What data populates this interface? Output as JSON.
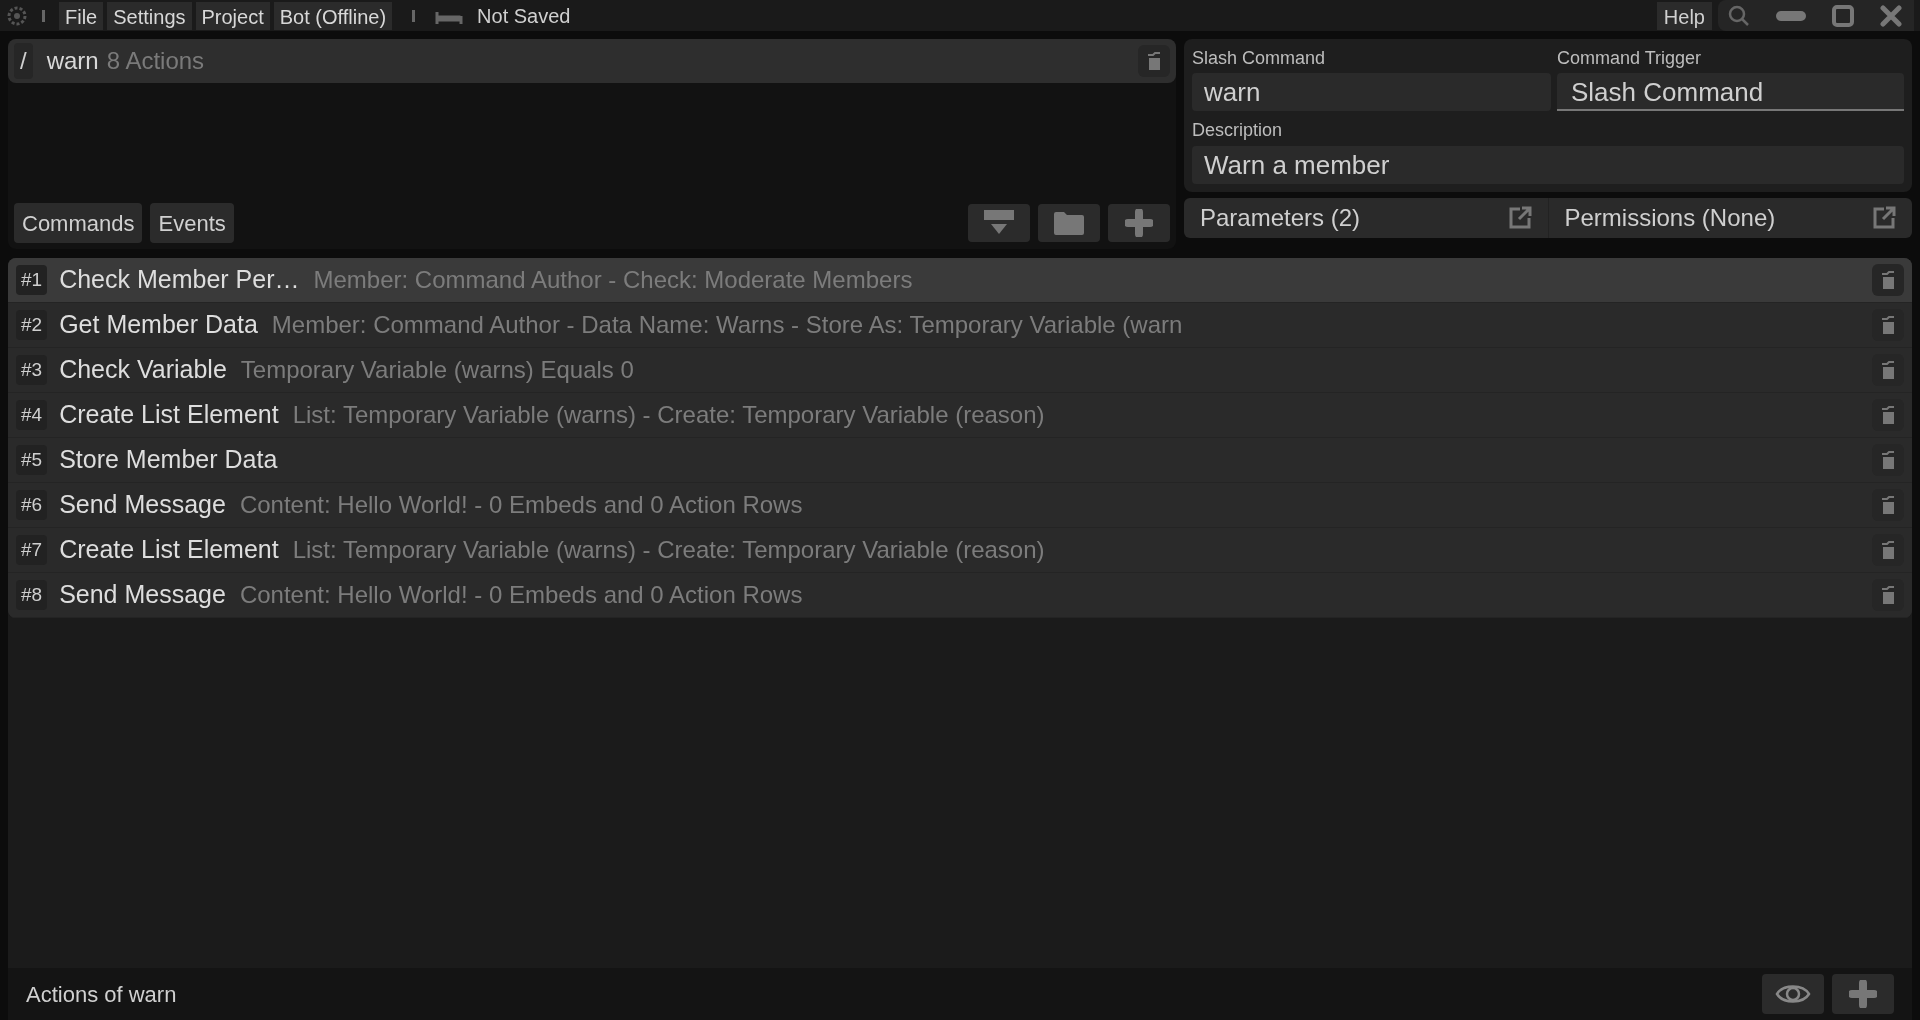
{
  "menu_bar": {
    "menus": [
      "File",
      "Settings",
      "Project",
      "Bot (Offline)"
    ],
    "save_status": "Not Saved",
    "help": "Help"
  },
  "command_header": {
    "prefix": "/",
    "name": "warn",
    "action_count": "8 Actions"
  },
  "list_tabs": [
    {
      "label": "Commands"
    },
    {
      "label": "Events"
    }
  ],
  "command_settings": {
    "slash_command": {
      "label": "Slash Command",
      "value": "warn"
    },
    "trigger": {
      "label": "Command Trigger",
      "value": "Slash Command"
    },
    "description": {
      "label": "Description",
      "value": "Warn a member"
    },
    "parameters": "Parameters (2)",
    "permissions": "Permissions (None)"
  },
  "actions": [
    {
      "number": "#1",
      "name": "Check Member Per…",
      "summary": "Member: Command Author - Check: Moderate Members",
      "selected": true
    },
    {
      "number": "#2",
      "name": "Get Member Data",
      "summary": "Member: Command Author - Data Name: Warns - Store As: Temporary Variable (warn",
      "selected": false
    },
    {
      "number": "#3",
      "name": "Check Variable",
      "summary": "Temporary Variable (warns) Equals 0",
      "selected": false
    },
    {
      "number": "#4",
      "name": "Create List Element",
      "summary": "List: Temporary Variable (warns) - Create: Temporary Variable (reason)",
      "selected": false
    },
    {
      "number": "#5",
      "name": "Store Member Data",
      "selected": false
    },
    {
      "number": "#6",
      "name": "Send Message",
      "summary": "Content: Hello World! - 0 Embeds and 0 Action Rows",
      "selected": false
    },
    {
      "number": "#7",
      "name": "Create List Element",
      "summary": "List: Temporary Variable (warns) - Create: Temporary Variable (reason)",
      "selected": false
    },
    {
      "number": "#8",
      "name": "Send Message",
      "summary": "Content: Hello World! - 0 Embeds and 0 Action Rows",
      "selected": false
    }
  ],
  "status_bar": {
    "title": "Actions of warn"
  }
}
